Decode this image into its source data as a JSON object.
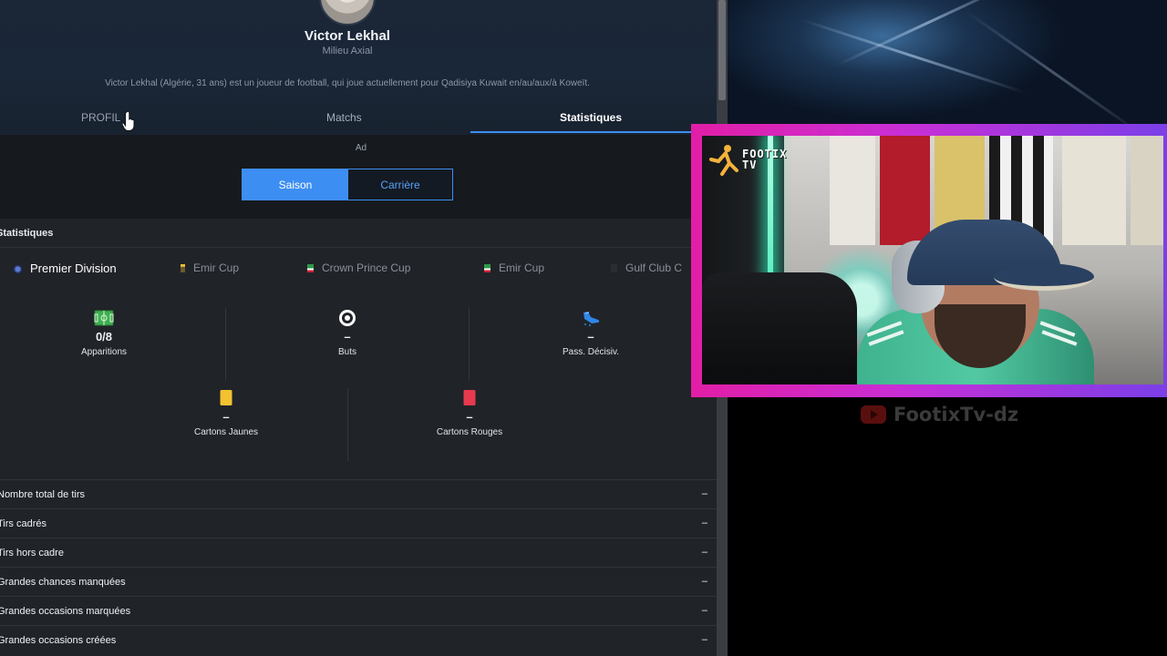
{
  "player": {
    "name": "Victor Lekhal",
    "position": "Milieu Axial",
    "bio": "Victor Lekhal (Algérie, 31 ans) est un joueur de football, qui joue actuellement pour Qadisiya Kuwait en/au/aux/à Koweït."
  },
  "tabs": {
    "profil": "PROFIL",
    "matchs": "Matchs",
    "statistiques": "Statistiques",
    "active": "statistiques"
  },
  "ad_label": "Ad",
  "toggle": {
    "saison": "Saison",
    "carriere": "Carrière",
    "selected": "saison"
  },
  "stats_section": {
    "header": "Statistiques",
    "competitions": [
      {
        "label": "Premier Division",
        "active": true
      },
      {
        "label": "Emir Cup",
        "active": false
      },
      {
        "label": "Crown Prince Cup",
        "active": false
      },
      {
        "label": "Emir Cup",
        "active": false
      },
      {
        "label": "Gulf Club C",
        "active": false
      }
    ],
    "summary": {
      "apparitions": {
        "value": "0/8",
        "label": "Apparitions",
        "icon": "pitch-icon"
      },
      "buts": {
        "value": "–",
        "label": "Buts",
        "icon": "ball-icon"
      },
      "pass": {
        "value": "–",
        "label": "Pass. Décisiv.",
        "icon": "boot-icon"
      },
      "jaunes": {
        "value": "–",
        "label": "Cartons Jaunes",
        "icon": "yellow-card-icon"
      },
      "rouges": {
        "value": "–",
        "label": "Cartons Rouges",
        "icon": "red-card-icon"
      }
    },
    "rows": [
      {
        "name": "Nombre total de tirs",
        "value": "–"
      },
      {
        "name": "Tirs cadrés",
        "value": "–"
      },
      {
        "name": "Tirs hors cadre",
        "value": "–"
      },
      {
        "name": "Grandes chances manquées",
        "value": "–"
      },
      {
        "name": "Grandes occasions marquées",
        "value": "–"
      },
      {
        "name": "Grandes occasions créées",
        "value": "–"
      }
    ]
  },
  "stream": {
    "cam_logo": "FOOTIX TV",
    "brand": "FootixTv-dz",
    "brand_icon": "youtube-icon"
  },
  "colors": {
    "accent": "#3d8ef2",
    "cam_frame_left": "#e21ea6",
    "cam_frame_right": "#7b3fe8",
    "yellow_card": "#f2c230",
    "red_card": "#e83a4e",
    "pitch_icon": "#3fae4f"
  }
}
